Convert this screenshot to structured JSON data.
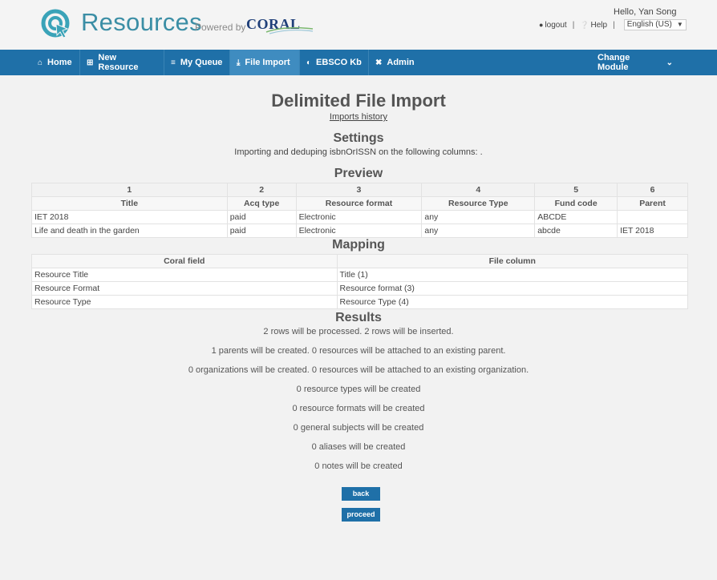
{
  "header": {
    "app_title": "Resources",
    "powered_by": "Powered by",
    "coral_logo": "CORAL",
    "greeting": "Hello, Yan Song",
    "logout": "logout",
    "help": "Help",
    "language": "English (US)",
    "colors": {
      "brand": "#3b8ea5",
      "coral": "#1f3f79"
    }
  },
  "nav": {
    "items": [
      {
        "label": "Home",
        "icon": "home-icon"
      },
      {
        "label": "New Resource",
        "icon": "plus-square-icon"
      },
      {
        "label": "My Queue",
        "icon": "stack-icon"
      },
      {
        "label": "File Import",
        "icon": "download-icon"
      },
      {
        "label": "EBSCO Kb",
        "icon": "ebsco-icon"
      },
      {
        "label": "Admin",
        "icon": "wrench-icon"
      }
    ],
    "active": "File Import",
    "change_module": "Change Module",
    "colors": {
      "bar": "#1f70a8",
      "active": "#3f8cc0"
    }
  },
  "main": {
    "title": "Delimited File Import",
    "history_link": "Imports history",
    "settings_heading": "Settings",
    "settings_text": "Importing and deduping isbnOrISSN on the following columns: .",
    "preview_heading": "Preview",
    "preview": {
      "numbers": [
        "1",
        "2",
        "3",
        "4",
        "5",
        "6"
      ],
      "headers": [
        "Title",
        "Acq type",
        "Resource format",
        "Resource Type",
        "Fund code",
        "Parent"
      ],
      "rows": [
        [
          "IET 2018",
          "paid",
          "Electronic",
          "any",
          "ABCDE",
          ""
        ],
        [
          "Life and death in the garden",
          "paid",
          "Electronic",
          "any",
          "abcde",
          "IET 2018"
        ]
      ]
    },
    "mapping_heading": "Mapping",
    "mapping": {
      "headers": [
        "Coral field",
        "File column"
      ],
      "rows": [
        [
          "Resource Title",
          "Title (1)"
        ],
        [
          "Resource Format",
          "Resource format (3)"
        ],
        [
          "Resource Type",
          "Resource Type (4)"
        ]
      ]
    },
    "results_heading": "Results",
    "results": [
      "2 rows will be processed. 2 rows will be inserted.",
      "1 parents will be created. 0 resources will be attached to an existing parent.",
      "0 organizations will be created. 0 resources will be attached to an existing organization.",
      "0 resource types will be created",
      "0 resource formats will be created",
      "0 general subjects will be created",
      "0 aliases will be created",
      "0 notes will be created"
    ],
    "back_button": "back",
    "proceed_button": "proceed"
  }
}
